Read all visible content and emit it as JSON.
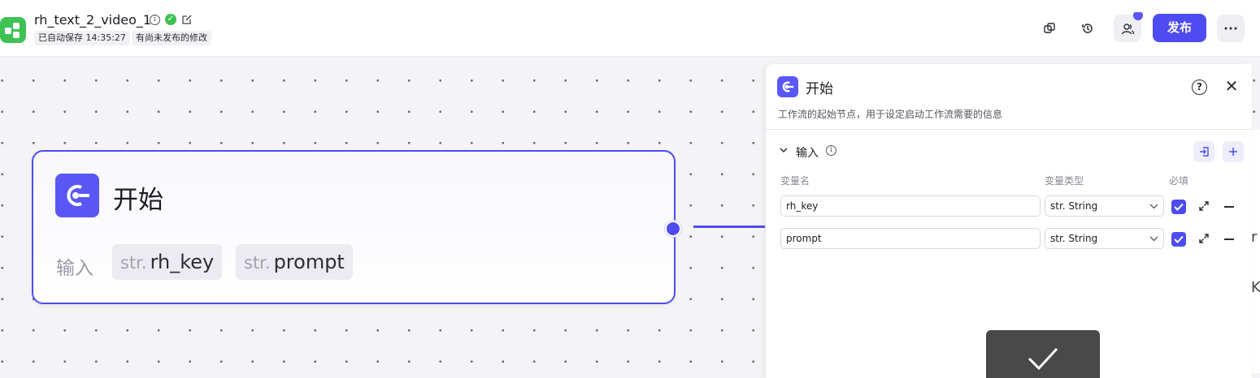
{
  "header": {
    "app_title": "rh_text_2_video_1",
    "autosave_status": "已自动保存 14:35:27",
    "unpublished_status": "有尚未发布的修改",
    "publish_label": "发布",
    "icons": {
      "logo": "workflow-logo-icon",
      "info": "info-icon",
      "verified": "check-circle-icon",
      "edit": "edit-icon",
      "copy": "copy-icon",
      "history": "history-icon",
      "collaborators": "users-icon",
      "more": "more-horizontal-icon"
    }
  },
  "node": {
    "title": "开始",
    "input_label": "输入",
    "inputs": [
      {
        "type": "str.",
        "name": "rh_key"
      },
      {
        "type": "str.",
        "name": "prompt"
      }
    ]
  },
  "panel": {
    "title": "开始",
    "description": "工作流的起始节点，用于设定启动工作流需要的信息",
    "section_title": "输入",
    "columns": {
      "name": "变量名",
      "type": "变量类型",
      "required": "必填"
    },
    "rows": [
      {
        "name": "rh_key",
        "type": "str. String",
        "required": true
      },
      {
        "name": "prompt",
        "type": "str. String",
        "required": true
      }
    ]
  },
  "edge_glyphs": [
    "r",
    "K"
  ],
  "colors": {
    "accent": "#4e4cf0",
    "logo_green": "#3ec254",
    "toast": "#494949"
  }
}
